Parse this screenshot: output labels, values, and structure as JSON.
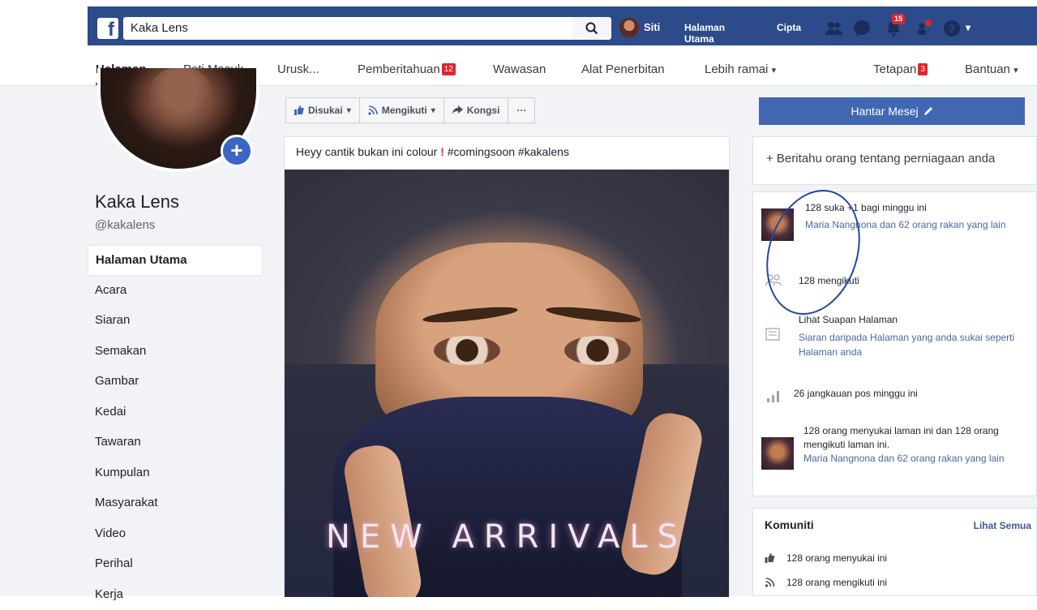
{
  "topbar": {
    "logo": "f",
    "search_value": "Kaka Lens",
    "user_name": "Siti",
    "home_link": "Halaman Utama",
    "create_link": "Cipta",
    "notif_badge": "15",
    "colors": {
      "bar": "#2d4a8a",
      "badge": "#e0242e"
    }
  },
  "subnav": {
    "items": [
      {
        "label": "Halaman",
        "active": true
      },
      {
        "label": "Peti Masuk"
      },
      {
        "label": "Urusk..."
      },
      {
        "label": "Pemberitahuan",
        "badge": "12"
      },
      {
        "label": "Wawasan"
      },
      {
        "label": "Alat Penerbitan"
      },
      {
        "label": "Lebih ramai",
        "caret": "▾"
      },
      {
        "label": "Tetapan",
        "badge": "3"
      },
      {
        "label": "Bantuan",
        "caret": "▾"
      }
    ]
  },
  "page": {
    "name": "Kaka Lens",
    "handle": "@kakalens"
  },
  "sidebar": {
    "items": [
      "Halaman Utama",
      "Acara",
      "Siaran",
      "Semakan",
      "Gambar",
      "Kedai",
      "Tawaran",
      "Kumpulan",
      "Masyarakat",
      "Video",
      "Perihal",
      "Kerja"
    ]
  },
  "actions": {
    "liked": "Disukai",
    "following": "Mengikuti",
    "share": "Kongsi",
    "more": "···"
  },
  "post": {
    "text_before": "Heyy cantik bukan ini colour",
    "exclaim": "!",
    "text_after": "#comingsoon #kakalens",
    "image_caption": "NEW ARRIVALS"
  },
  "right": {
    "send_message": "Hantar Mesej",
    "tell_people": "+ Beritahu orang tentang perniagaan anda",
    "likes_line": "128 suka +1 bagi minggu ini",
    "likes_sub": "Maria Nangnona dan 62 orang rakan yang lain",
    "followers": "128 mengikuti",
    "feed_title": "Lihat Suapan Halaman",
    "feed_sub": "Siaran daripada Halaman yang anda sukai seperti Halaman anda",
    "reach": "26 jangkauan pos minggu ini",
    "summary": "128 orang menyukai laman ini dan 128 orang mengikuti laman ini.",
    "summary_sub": "Maria Nangnona dan 62 orang rakan yang lain",
    "community_title": "Komuniti",
    "see_all": "Lihat Semua",
    "comm_likes": "128 orang menyukai ini",
    "comm_follows": "128 orang mengikuti ini"
  }
}
